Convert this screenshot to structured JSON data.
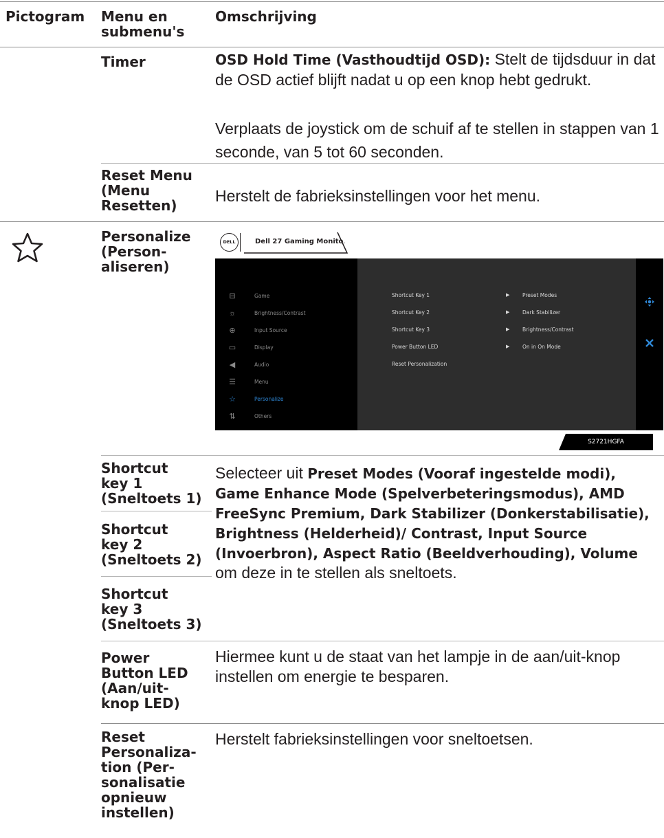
{
  "table": {
    "headers": {
      "pictogram": "Pictogram",
      "menu": "Menu en submenu's",
      "description": "Omschrijving"
    },
    "rows": {
      "timer": {
        "menu": "Timer",
        "desc1_bold": "OSD Hold Time (Vasthoudtijd OSD):",
        "desc1_rest": "Stelt de tijdsduur in dat de OSD actief blijft nadat u op een knop hebt gedrukt.",
        "desc2": "Verplaats de joystick om de schuif af te stellen in stappen van 1 seconde, van 5 tot 60 seconden."
      },
      "reset_menu": {
        "menu_line1": "Reset Menu",
        "menu_line2": "(Menu",
        "menu_line3": "Resetten)",
        "desc": "Herstelt de fabrieksinstellingen voor het menu."
      },
      "personalize": {
        "icon": "star-outline-icon",
        "menu_line1": "Personalize",
        "menu_line2": "(Person-",
        "menu_line3": "aliseren)"
      },
      "shortcut": {
        "key1": [
          "Shortcut",
          "key 1",
          "(Sneltoets 1)"
        ],
        "key2": [
          "Shortcut",
          "key 2",
          "(Sneltoets 2)"
        ],
        "key3": [
          "Shortcut",
          "key 3",
          "(Sneltoets 3)"
        ],
        "desc_intro": "Selecteer uit",
        "desc_bold": "Preset Modes (Vooraf ingestelde modi), Game Enhance Mode (Spelverbeteringsmodus), AMD FreeSync Premium, Dark Stabilizer (Donkerstabilisatie), Brightness (Helderheid)/ Contrast, Input Source (Invoerbron), Aspect Ratio (Beeldverhouding), Volume",
        "desc_end": "om deze in te stellen als sneltoets."
      },
      "power_led": {
        "menu": [
          "Power",
          "Button LED",
          "(Aan/uit-",
          "knop LED)"
        ],
        "desc": "Hiermee kunt u de staat van het lampje in de aan/uit-knop instellen om energie te besparen."
      },
      "reset_personalization": {
        "menu": [
          "Reset",
          "Personaliza-",
          "tion (Per-",
          "sonalisatie",
          "opnieuw",
          "instellen)"
        ],
        "desc": "Herstelt fabrieksinstellingen voor sneltoetsen."
      }
    }
  },
  "osd": {
    "logo_text": "DELL",
    "title": "Dell 27 Gaming Monitor",
    "model": "S2721HGFA",
    "menu_items": [
      {
        "label": "Game",
        "icon": "game-icon",
        "glyph": "⊟"
      },
      {
        "label": "Brightness/Contrast",
        "icon": "brightness-icon",
        "glyph": "☼"
      },
      {
        "label": "Input Source",
        "icon": "input-source-icon",
        "glyph": "⊕"
      },
      {
        "label": "Display",
        "icon": "display-icon",
        "glyph": "▭"
      },
      {
        "label": "Audio",
        "icon": "audio-icon",
        "glyph": "◀"
      },
      {
        "label": "Menu",
        "icon": "menu-icon",
        "glyph": "☰"
      },
      {
        "label": "Personalize",
        "icon": "star-icon",
        "glyph": "☆",
        "active": true
      },
      {
        "label": "Others",
        "icon": "others-icon",
        "glyph": "⇅"
      }
    ],
    "settings": [
      {
        "key": "Shortcut Key 1",
        "value": "Preset Modes"
      },
      {
        "key": "Shortcut Key 2",
        "value": "Dark Stabilizer"
      },
      {
        "key": "Shortcut Key 3",
        "value": "Brightness/Contrast"
      },
      {
        "key": "Power Button LED",
        "value": "On in On Mode"
      },
      {
        "key": "Reset Personalization",
        "value": ""
      }
    ],
    "accent_color": "#2e86d4"
  }
}
